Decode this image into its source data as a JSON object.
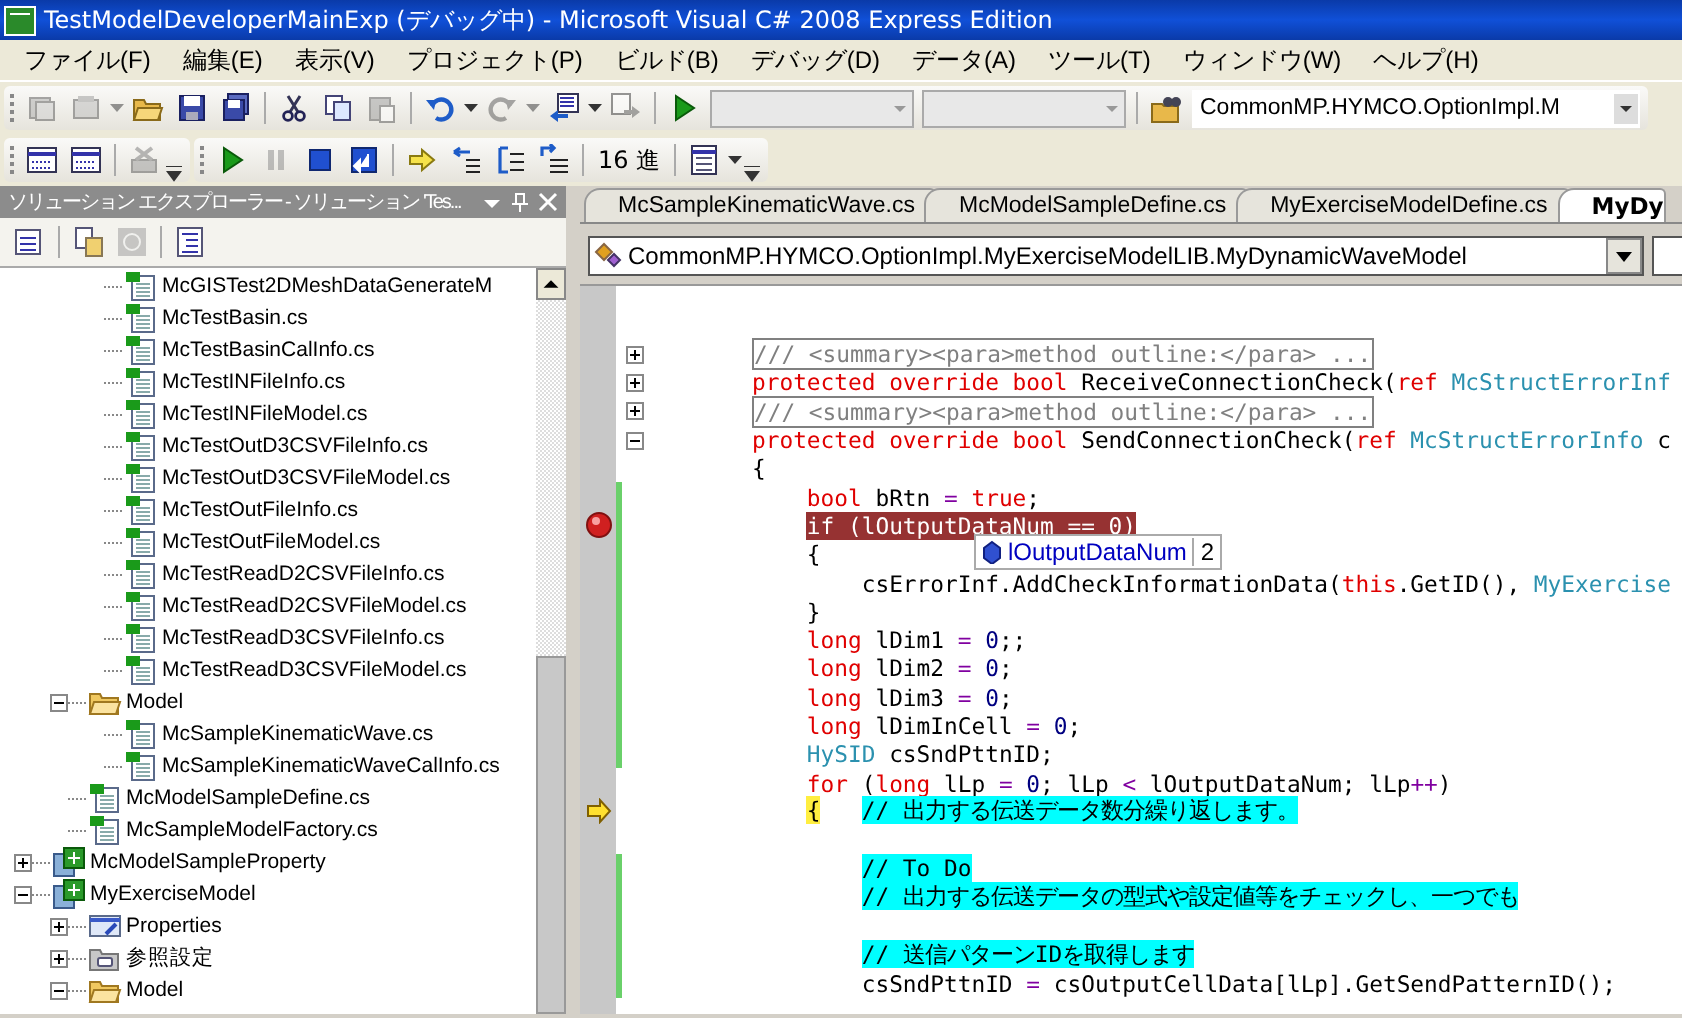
{
  "window": {
    "title": "TestModelDeveloperMainExp (デバッグ中) - Microsoft Visual C# 2008 Express Edition"
  },
  "menu": [
    "ファイル(F)",
    "編集(E)",
    "表示(V)",
    "プロジェクト(P)",
    "ビルド(B)",
    "デバッグ(D)",
    "データ(A)",
    "ツール(T)",
    "ウィンドウ(W)",
    "ヘルプ(H)"
  ],
  "toolbar_rows": [
    {
      "toolbars": [
        {
          "items": [
            {
              "kind": "newproject",
              "disabled": true
            },
            {
              "kind": "additem",
              "disabled": true
            },
            {
              "kind": "dropdown",
              "disabled": true
            },
            {
              "kind": "open",
              "disabled": false
            },
            {
              "kind": "save",
              "disabled": false
            },
            {
              "kind": "saveall",
              "disabled": false
            },
            {
              "kind": "separator"
            },
            {
              "kind": "cut",
              "disabled": false
            },
            {
              "kind": "copy",
              "disabled": false
            },
            {
              "kind": "paste",
              "disabled": true
            },
            {
              "kind": "separator"
            },
            {
              "kind": "undo",
              "disabled": false
            },
            {
              "kind": "dropdown",
              "disabled": false
            },
            {
              "kind": "redo",
              "disabled": true
            },
            {
              "kind": "dropdown",
              "disabled": true
            },
            {
              "kind": "navigate",
              "disabled": false
            },
            {
              "kind": "dropdown",
              "disabled": false
            },
            {
              "kind": "forward",
              "disabled": true
            },
            {
              "kind": "separator"
            },
            {
              "kind": "play",
              "disabled": false
            },
            {
              "kind": "combo",
              "disabled": true
            },
            {
              "kind": "combo",
              "disabled": true
            },
            {
              "kind": "separator"
            },
            {
              "kind": "find",
              "disabled": false
            },
            {
              "kind": "combo",
              "disabled": false,
              "value": "CommonMP.HYMCO.OptionImpl.M"
            }
          ]
        }
      ]
    },
    {
      "toolbars": [
        {
          "items": [
            {
              "kind": "breakpoints",
              "disabled": false
            },
            {
              "kind": "breakpoints",
              "disabled": false
            },
            {
              "kind": "separator"
            },
            {
              "kind": "delete",
              "disabled": true
            },
            {
              "kind": "overflow"
            }
          ]
        },
        {
          "items": [
            {
              "kind": "play",
              "disabled": false
            },
            {
              "kind": "pause",
              "disabled": true
            },
            {
              "kind": "stop",
              "disabled": false
            },
            {
              "kind": "restart",
              "disabled": false
            },
            {
              "kind": "separator"
            },
            {
              "kind": "nextstatement",
              "disabled": false
            },
            {
              "kind": "stepinto",
              "disabled": false
            },
            {
              "kind": "stepover",
              "disabled": false
            },
            {
              "kind": "stepout",
              "disabled": false
            },
            {
              "kind": "separator"
            },
            {
              "kind": "text",
              "label": "16 進"
            },
            {
              "kind": "separator"
            },
            {
              "kind": "window",
              "disabled": false
            },
            {
              "kind": "dropdown",
              "disabled": false
            },
            {
              "kind": "overflow"
            }
          ]
        }
      ]
    }
  ],
  "solution_explorer": {
    "title": "ソリューション エクスプローラー - ソリューション 'Tes...",
    "tree": [
      {
        "children": [
          {
            "children": [
              {
                "label": "McGISTest2DMeshDataGenerateM",
                "kind": "csfile"
              },
              {
                "label": "McTestBasin.cs",
                "kind": "csfile"
              },
              {
                "label": "McTestBasinCalInfo.cs",
                "kind": "csfile"
              },
              {
                "label": "McTestINFileInfo.cs",
                "kind": "csfile"
              },
              {
                "label": "McTestINFileModel.cs",
                "kind": "csfile"
              },
              {
                "label": "McTestOutD3CSVFileInfo.cs",
                "kind": "csfile"
              },
              {
                "label": "McTestOutD3CSVFileModel.cs",
                "kind": "csfile"
              },
              {
                "label": "McTestOutFileInfo.cs",
                "kind": "csfile"
              },
              {
                "label": "McTestOutFileModel.cs",
                "kind": "csfile"
              },
              {
                "label": "McTestReadD2CSVFileInfo.cs",
                "kind": "csfile"
              },
              {
                "label": "McTestReadD2CSVFileModel.cs",
                "kind": "csfile"
              },
              {
                "label": "McTestReadD3CSVFileInfo.cs",
                "kind": "csfile"
              },
              {
                "label": "McTestReadD3CSVFileModel.cs",
                "kind": "csfile"
              }
            ]
          },
          {
            "label": "Model",
            "kind": "folder",
            "expanded": true,
            "children": [
              {
                "label": "McSampleKinematicWave.cs",
                "kind": "csfile"
              },
              {
                "label": "McSampleKinematicWaveCalInfo.cs",
                "kind": "csfile"
              }
            ]
          },
          {
            "label": "McModelSampleDefine.cs",
            "kind": "csfile"
          },
          {
            "label": "McSampleModelFactory.cs",
            "kind": "csfile"
          }
        ]
      },
      {
        "label": "McModelSampleProperty",
        "kind": "project",
        "expanded": false
      },
      {
        "label": "MyExerciseModel",
        "kind": "project",
        "expanded": true,
        "children": [
          {
            "label": "Properties",
            "kind": "properties",
            "expanded": false
          },
          {
            "label": "参照設定",
            "kind": "references",
            "expanded": false
          },
          {
            "label": "Model",
            "kind": "folder",
            "expanded": true
          }
        ]
      }
    ]
  },
  "editor": {
    "tabs": [
      {
        "label": "McSampleKinematicWave.cs",
        "selected": false
      },
      {
        "label": "McModelSampleDefine.cs",
        "selected": false
      },
      {
        "label": "MyExerciseModelDefine.cs",
        "selected": false
      },
      {
        "label": "MyDy",
        "selected": true
      }
    ],
    "type_dropdown": "CommonMP.HYMCO.OptionImpl.MyExerciseModelLIB.MyDynamicWaveModel",
    "lines": [
      {
        "expanded": false,
        "changed": false,
        "tokens": [
          {
            "kind": "outline",
            "text": "/// <summary><para>method outline:</para> ..."
          }
        ]
      },
      {
        "expanded": false,
        "changed": false,
        "tokens": [
          {
            "kind": "keyword",
            "text": "protected override bool"
          },
          {
            "kind": "plain",
            "text": " ReceiveConnectionCheck("
          },
          {
            "kind": "keyword",
            "text": "ref"
          },
          {
            "kind": "type",
            "text": " McStructErrorInf"
          }
        ]
      },
      {
        "expanded": false,
        "changed": false,
        "tokens": [
          {
            "kind": "outline",
            "text": "/// <summary><para>method outline:</para> ..."
          }
        ]
      },
      {
        "expanded": true,
        "changed": false,
        "tokens": [
          {
            "kind": "keyword",
            "text": "protected override bool"
          },
          {
            "kind": "plain",
            "text": " SendConnectionCheck("
          },
          {
            "kind": "keyword",
            "text": "ref"
          },
          {
            "kind": "type",
            "text": " McStructErrorInfo"
          },
          {
            "kind": "plain",
            "text": " c"
          }
        ]
      },
      {
        "changed": false,
        "tokens": [
          {
            "kind": "plain",
            "text": "{"
          }
        ],
        "children": [
          {
            "changed": true,
            "tokens": [
              {
                "kind": "keyword",
                "text": "bool"
              },
              {
                "kind": "plain",
                "text": " bRtn "
              },
              {
                "kind": "operator",
                "text": "="
              },
              {
                "kind": "keyword",
                "text": " true"
              },
              {
                "kind": "plain",
                "text": ";"
              }
            ]
          },
          {
            "changed": true,
            "has_breakpoint": true,
            "tokens": [
              {
                "kind": "breakpoint",
                "text": "if (lOutputDataNum == 0)"
              }
            ]
          },
          {
            "changed": true,
            "tokens": [
              {
                "kind": "plain",
                "text": "{"
              }
            ],
            "children": [
              {
                "changed": true,
                "tokens": [
                  {
                    "kind": "plain",
                    "text": "csErrorInf.AddCheckInformationData("
                  },
                  {
                    "kind": "keyword",
                    "text": "this"
                  },
                  {
                    "kind": "plain",
                    "text": ".GetID(), "
                  },
                  {
                    "kind": "type",
                    "text": "MyExercise"
                  }
                ]
              }
            ]
          },
          {
            "changed": true,
            "tokens": [
              {
                "kind": "plain",
                "text": "}"
              }
            ]
          },
          {
            "changed": true,
            "tokens": [
              {
                "kind": "keyword",
                "text": "long"
              },
              {
                "kind": "plain",
                "text": " lDim1 "
              },
              {
                "kind": "operator",
                "text": "="
              },
              {
                "kind": "number",
                "text": " 0"
              },
              {
                "kind": "plain",
                "text": ";;"
              }
            ]
          },
          {
            "changed": true,
            "tokens": [
              {
                "kind": "keyword",
                "text": "long"
              },
              {
                "kind": "plain",
                "text": " lDim2 "
              },
              {
                "kind": "operator",
                "text": "="
              },
              {
                "kind": "number",
                "text": " 0"
              },
              {
                "kind": "plain",
                "text": ";"
              }
            ]
          },
          {
            "changed": true,
            "tokens": [
              {
                "kind": "keyword",
                "text": "long"
              },
              {
                "kind": "plain",
                "text": " lDim3 "
              },
              {
                "kind": "operator",
                "text": "="
              },
              {
                "kind": "number",
                "text": " 0"
              },
              {
                "kind": "plain",
                "text": ";"
              }
            ]
          },
          {
            "changed": true,
            "tokens": [
              {
                "kind": "keyword",
                "text": "long"
              },
              {
                "kind": "plain",
                "text": " lDimInCell "
              },
              {
                "kind": "operator",
                "text": "="
              },
              {
                "kind": "number",
                "text": " 0"
              },
              {
                "kind": "plain",
                "text": ";"
              }
            ]
          },
          {
            "changed": true,
            "tokens": [
              {
                "kind": "type",
                "text": "HySID"
              },
              {
                "kind": "plain",
                "text": " csSndPttnID;"
              }
            ]
          },
          {
            "changed": false,
            "tokens": [
              {
                "kind": "keyword",
                "text": "for"
              },
              {
                "kind": "plain",
                "text": " ("
              },
              {
                "kind": "keyword",
                "text": "long"
              },
              {
                "kind": "plain",
                "text": " lLp "
              },
              {
                "kind": "operator",
                "text": "="
              },
              {
                "kind": "number",
                "text": " 0"
              },
              {
                "kind": "plain",
                "text": "; lLp "
              },
              {
                "kind": "operator",
                "text": "<"
              },
              {
                "kind": "plain",
                "text": " lOutputDataNum; lLp"
              },
              {
                "kind": "operator",
                "text": "++"
              },
              {
                "kind": "plain",
                "text": ")"
              }
            ]
          },
          {
            "changed": false,
            "is_current": true,
            "tokens": [
              {
                "kind": "current",
                "text": "{"
              },
              {
                "kind": "comment",
                "text": "// 出力する伝送データ数分繰り返します。"
              }
            ],
            "children": [
              {
                "changed": false
              },
              {
                "changed": true,
                "tokens": [
                  {
                    "kind": "comment",
                    "text": "// To Do"
                  }
                ]
              },
              {
                "changed": true,
                "tokens": [
                  {
                    "kind": "comment",
                    "text": "// 出力する伝送データの型式や設定値等をチェックし、一つでも"
                  }
                ]
              },
              {
                "changed": true
              },
              {
                "changed": true,
                "tokens": [
                  {
                    "kind": "comment",
                    "text": "// 送信パターンIDを取得します"
                  }
                ]
              },
              {
                "changed": true,
                "tokens": [
                  {
                    "kind": "plain",
                    "text": "csSndPttnID "
                  },
                  {
                    "kind": "operator",
                    "text": "="
                  },
                  {
                    "kind": "plain",
                    "text": " csOutputCellData[lLp].GetSendPatternID();"
                  }
                ]
              }
            ]
          }
        ]
      }
    ],
    "datatip": {
      "name": "lOutputDataNum",
      "value": "2"
    }
  }
}
